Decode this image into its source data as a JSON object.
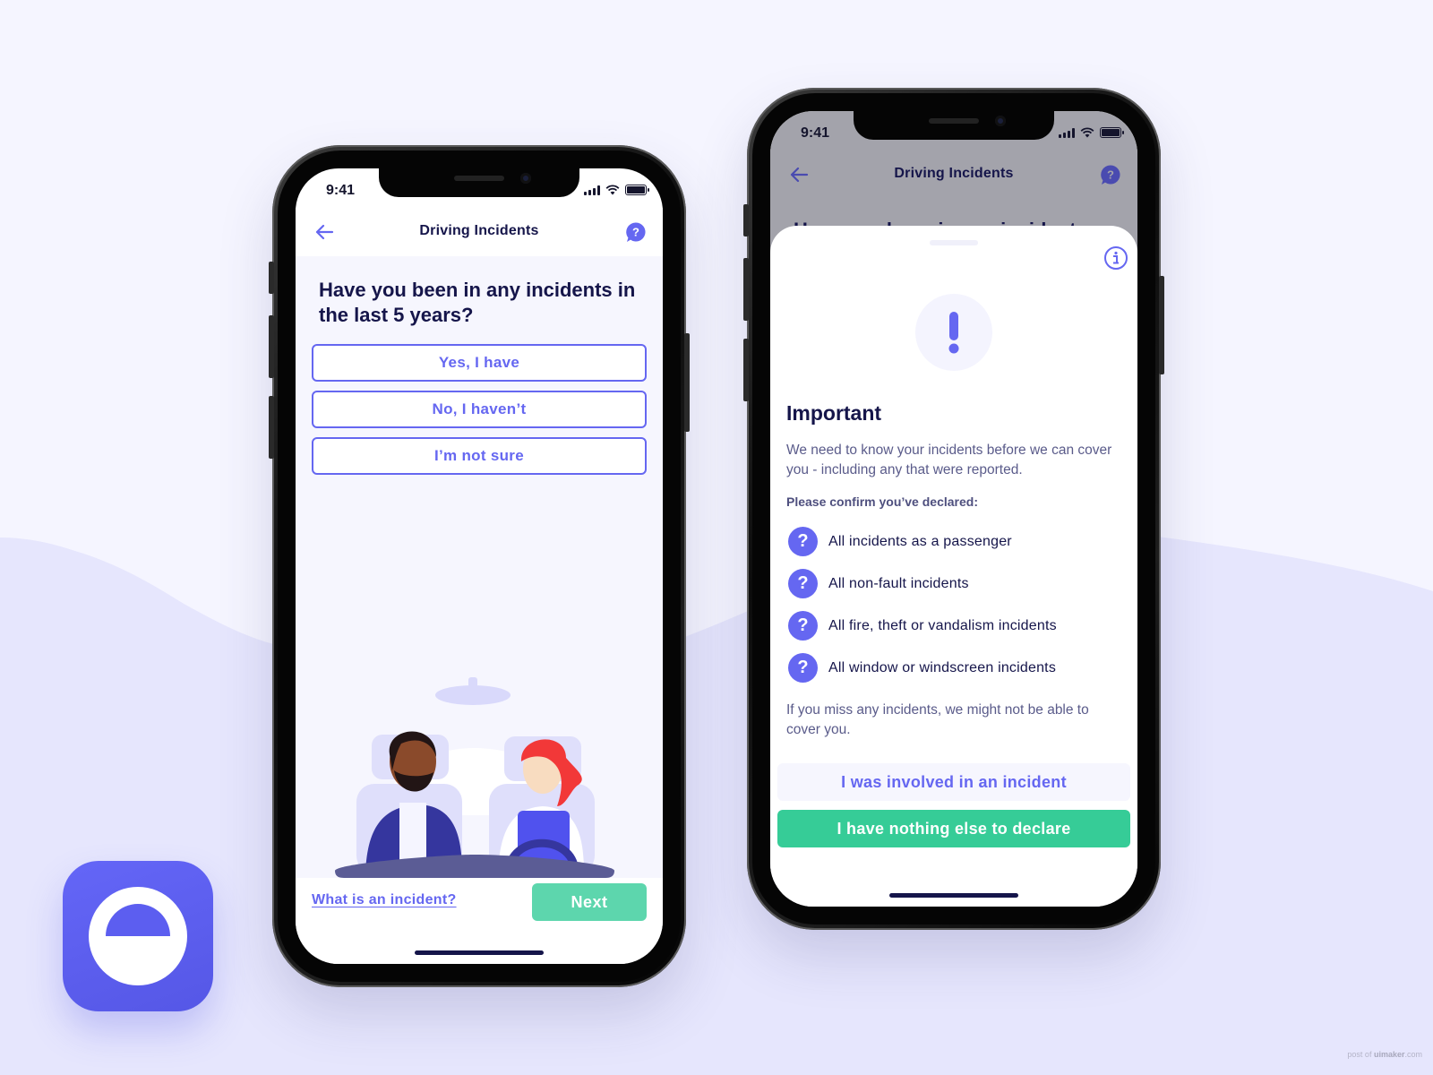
{
  "colors": {
    "brand": "#6567f1",
    "navy": "#15154a",
    "green_primary": "#36cc97",
    "green_disabled": "#5dd6ad",
    "background": "#f5f5ff",
    "wave": "#e6e6fd"
  },
  "left_phone": {
    "statusbar": {
      "time": "9:41"
    },
    "navbar": {
      "title": "Driving Incidents",
      "back_icon": "arrow-left-icon",
      "help_icon": "help-chat-icon"
    },
    "question": "Have you been in any incidents in the last 5 years?",
    "options": [
      {
        "label": "Yes, I have"
      },
      {
        "label": "No, I haven’t"
      },
      {
        "label": "I’m not sure"
      }
    ],
    "illustration": "two-people-in-car",
    "footer": {
      "link": "What is an incident?",
      "next": "Next"
    }
  },
  "right_phone": {
    "statusbar": {
      "time": "9:41"
    },
    "navbar": {
      "title": "Driving Incidents",
      "back_icon": "arrow-left-icon",
      "help_icon": "help-chat-icon"
    },
    "behind_title": "Have you been in any incidents",
    "sheet": {
      "info_icon": "info-icon",
      "alert_icon": "exclamation-icon",
      "heading": "Important",
      "intro": "We need to know your incidents before we can cover you - including any that were reported.",
      "confirm_label": "Please confirm you’ve declared:",
      "items": [
        {
          "icon": "question-icon",
          "label": "All incidents as a passenger"
        },
        {
          "icon": "question-icon",
          "label": "All non-fault incidents"
        },
        {
          "icon": "question-icon",
          "label": "All fire, theft or vandalism incidents"
        },
        {
          "icon": "question-icon",
          "label": "All window or windscreen incidents"
        }
      ],
      "outro": "If you miss any incidents, we might not be able to cover you.",
      "secondary_button": "I was involved in an incident",
      "primary_button": "I have nothing else to declare"
    }
  },
  "app_icon": {
    "name": "app-logo-icon"
  },
  "watermark": {
    "prefix": "post of ",
    "brand": "uimaker",
    "suffix": ".com"
  }
}
